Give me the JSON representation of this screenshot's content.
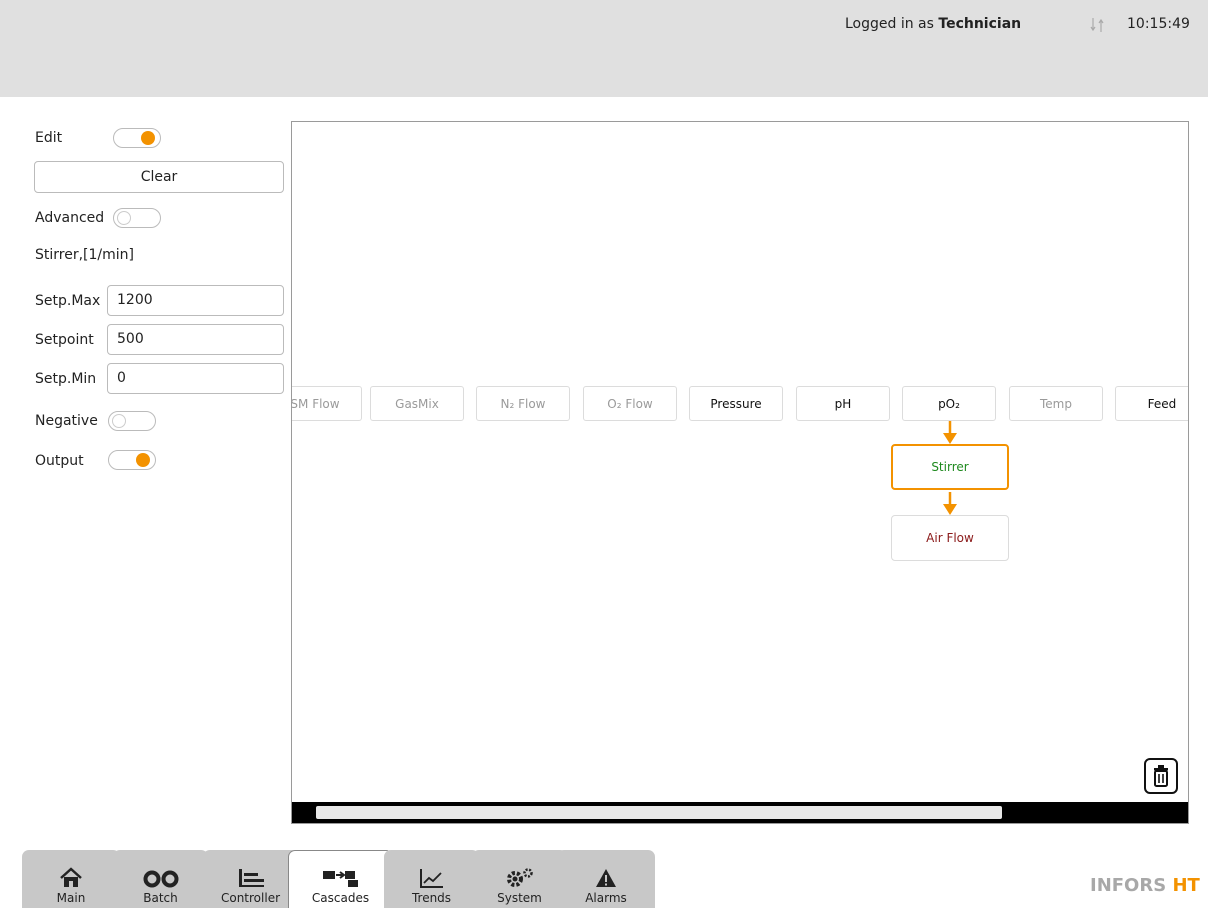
{
  "header": {
    "login_prefix": "Logged in as",
    "user": "Technician",
    "time": "10:15:49"
  },
  "left_panel": {
    "edit_label": "Edit",
    "edit_on": true,
    "clear_label": "Clear",
    "advanced_label": "Advanced",
    "advanced_on": false,
    "parameter_label": "Stirrer,[1/min]",
    "setp_max_label": "Setp.Max",
    "setp_max_value": "1200",
    "setpoint_label": "Setpoint",
    "setpoint_value": "500",
    "setp_min_label": "Setp.Min",
    "setp_min_value": "0",
    "negative_label": "Negative",
    "negative_on": false,
    "output_label": "Output",
    "output_on": true
  },
  "cascade": {
    "nodes": [
      {
        "label": "SM Flow",
        "enabled": false
      },
      {
        "label": "GasMix",
        "enabled": false
      },
      {
        "label": "N₂ Flow",
        "enabled": false
      },
      {
        "label": "O₂ Flow",
        "enabled": false
      },
      {
        "label": "Pressure",
        "enabled": true
      },
      {
        "label": "pH",
        "enabled": true
      },
      {
        "label": "pO₂",
        "enabled": true
      },
      {
        "label": "Temp",
        "enabled": false
      },
      {
        "label": "Feed",
        "enabled": true
      }
    ],
    "chain": [
      {
        "label": "Stirrer",
        "selected": true,
        "color": "#1f8a1f"
      },
      {
        "label": "Air Flow",
        "selected": false,
        "color": "#8b1a1a"
      }
    ],
    "accent_color": "#f39200"
  },
  "tabs": [
    {
      "label": "Main",
      "icon": "home-icon",
      "active": false
    },
    {
      "label": "Batch",
      "icon": "batch-icon",
      "active": false
    },
    {
      "label": "Controller",
      "icon": "controller-icon",
      "active": false
    },
    {
      "label": "Cascades",
      "icon": "cascades-icon",
      "active": true
    },
    {
      "label": "Trends",
      "icon": "trends-icon",
      "active": false
    },
    {
      "label": "System",
      "icon": "gears-icon",
      "active": false
    },
    {
      "label": "Alarms",
      "icon": "warning-icon",
      "active": false
    }
  ],
  "brand": {
    "name": "INFORS",
    "suffix": "HT"
  }
}
